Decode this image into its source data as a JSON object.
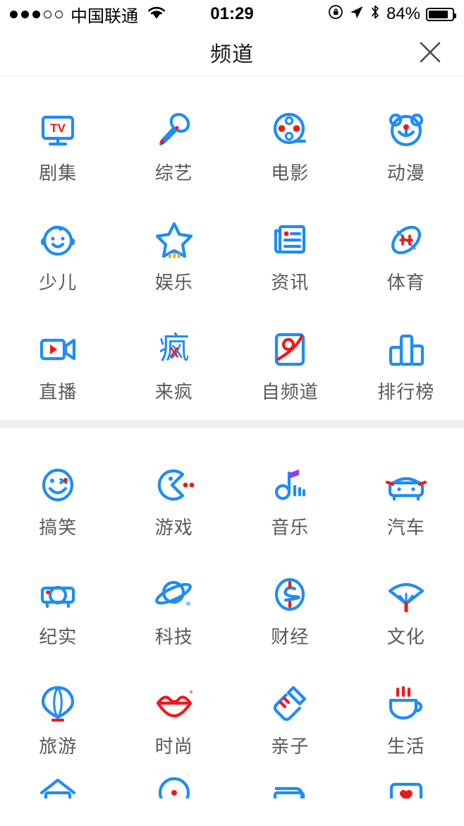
{
  "status_bar": {
    "signal_dots": [
      "filled",
      "filled",
      "filled",
      "hollow",
      "hollow"
    ],
    "carrier": "中国联通",
    "wifi_icon": "wifi-icon",
    "time": "01:29",
    "rotation_lock_icon": "rotation-lock-icon",
    "location_icon": "location-arrow-icon",
    "bluetooth_icon": "bluetooth-icon",
    "battery_percent": "84%",
    "battery_level": 84
  },
  "header": {
    "title": "频道",
    "close_icon": "close-icon"
  },
  "colors": {
    "accent_blue": "#1f8cf5",
    "accent_red": "#f01919",
    "accent_purple": "#8c3ff0",
    "accent_orange": "#f5a623",
    "label_gray": "#595959",
    "divider_gray": "#eeeeee"
  },
  "sections": [
    {
      "name": "primary-channels",
      "items": [
        {
          "label": "剧集",
          "icon": "tv-monitor-icon"
        },
        {
          "label": "综艺",
          "icon": "microphone-icon"
        },
        {
          "label": "电影",
          "icon": "film-reel-icon"
        },
        {
          "label": "动漫",
          "icon": "bear-face-icon"
        },
        {
          "label": "少儿",
          "icon": "baby-face-icon"
        },
        {
          "label": "娱乐",
          "icon": "star-icon"
        },
        {
          "label": "资讯",
          "icon": "newspaper-icon"
        },
        {
          "label": "体育",
          "icon": "football-icon"
        },
        {
          "label": "直播",
          "icon": "video-camera-icon"
        },
        {
          "label": "来疯",
          "icon": "feng-character-icon"
        },
        {
          "label": "自频道",
          "icon": "self-channel-icon"
        },
        {
          "label": "排行榜",
          "icon": "bar-chart-icon"
        }
      ]
    },
    {
      "name": "secondary-channels",
      "items": [
        {
          "label": "搞笑",
          "icon": "wink-smiley-icon"
        },
        {
          "label": "游戏",
          "icon": "pacman-icon"
        },
        {
          "label": "音乐",
          "icon": "music-note-icon"
        },
        {
          "label": "汽车",
          "icon": "car-front-icon"
        },
        {
          "label": "纪实",
          "icon": "projector-icon"
        },
        {
          "label": "科技",
          "icon": "planet-saturn-icon"
        },
        {
          "label": "财经",
          "icon": "dollar-circle-icon"
        },
        {
          "label": "文化",
          "icon": "folding-fan-icon"
        },
        {
          "label": "旅游",
          "icon": "hot-air-balloon-icon"
        },
        {
          "label": "时尚",
          "icon": "red-lips-icon"
        },
        {
          "label": "亲子",
          "icon": "baby-bottle-icon"
        },
        {
          "label": "生活",
          "icon": "coffee-cup-icon"
        }
      ]
    },
    {
      "name": "partially-visible-row",
      "items": [
        {
          "label": "",
          "icon": "house-roof-icon"
        },
        {
          "label": "",
          "icon": "clock-dial-icon"
        },
        {
          "label": "",
          "icon": "bed-icon"
        },
        {
          "label": "",
          "icon": "heart-box-icon"
        }
      ]
    }
  ]
}
